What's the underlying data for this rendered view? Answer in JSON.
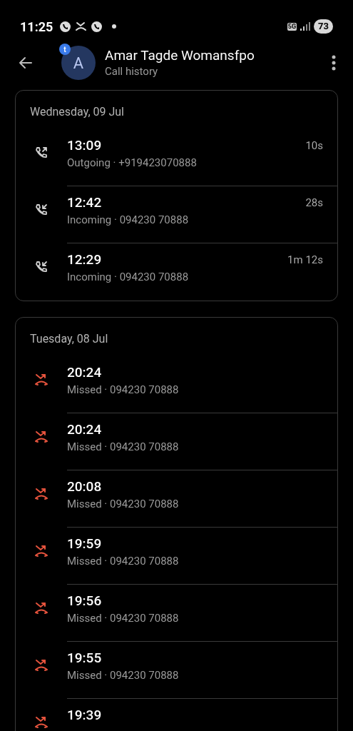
{
  "status_bar": {
    "time": "11:25",
    "network": "5G",
    "battery": "73"
  },
  "header": {
    "avatar_letter": "A",
    "badge": "t",
    "name": "Amar Tagde Womansfpo",
    "subtitle": "Call history"
  },
  "groups": [
    {
      "date": "Wednesday, 09 Jul",
      "calls": [
        {
          "kind": "outgoing",
          "time": "13:09",
          "detail": "Outgoing · +919423070888",
          "duration": "10s"
        },
        {
          "kind": "incoming",
          "time": "12:42",
          "detail": "Incoming · 094230 70888",
          "duration": "28s"
        },
        {
          "kind": "incoming",
          "time": "12:29",
          "detail": "Incoming · 094230 70888",
          "duration": "1m 12s"
        }
      ]
    },
    {
      "date": "Tuesday, 08 Jul",
      "calls": [
        {
          "kind": "missed",
          "time": "20:24",
          "detail": "Missed · 094230 70888"
        },
        {
          "kind": "missed",
          "time": "20:24",
          "detail": "Missed · 094230 70888"
        },
        {
          "kind": "missed",
          "time": "20:08",
          "detail": "Missed · 094230 70888"
        },
        {
          "kind": "missed",
          "time": "19:59",
          "detail": "Missed · 094230 70888"
        },
        {
          "kind": "missed",
          "time": "19:56",
          "detail": "Missed · 094230 70888"
        },
        {
          "kind": "missed",
          "time": "19:55",
          "detail": "Missed · 094230 70888"
        },
        {
          "kind": "missed",
          "time": "19:39"
        }
      ]
    }
  ]
}
